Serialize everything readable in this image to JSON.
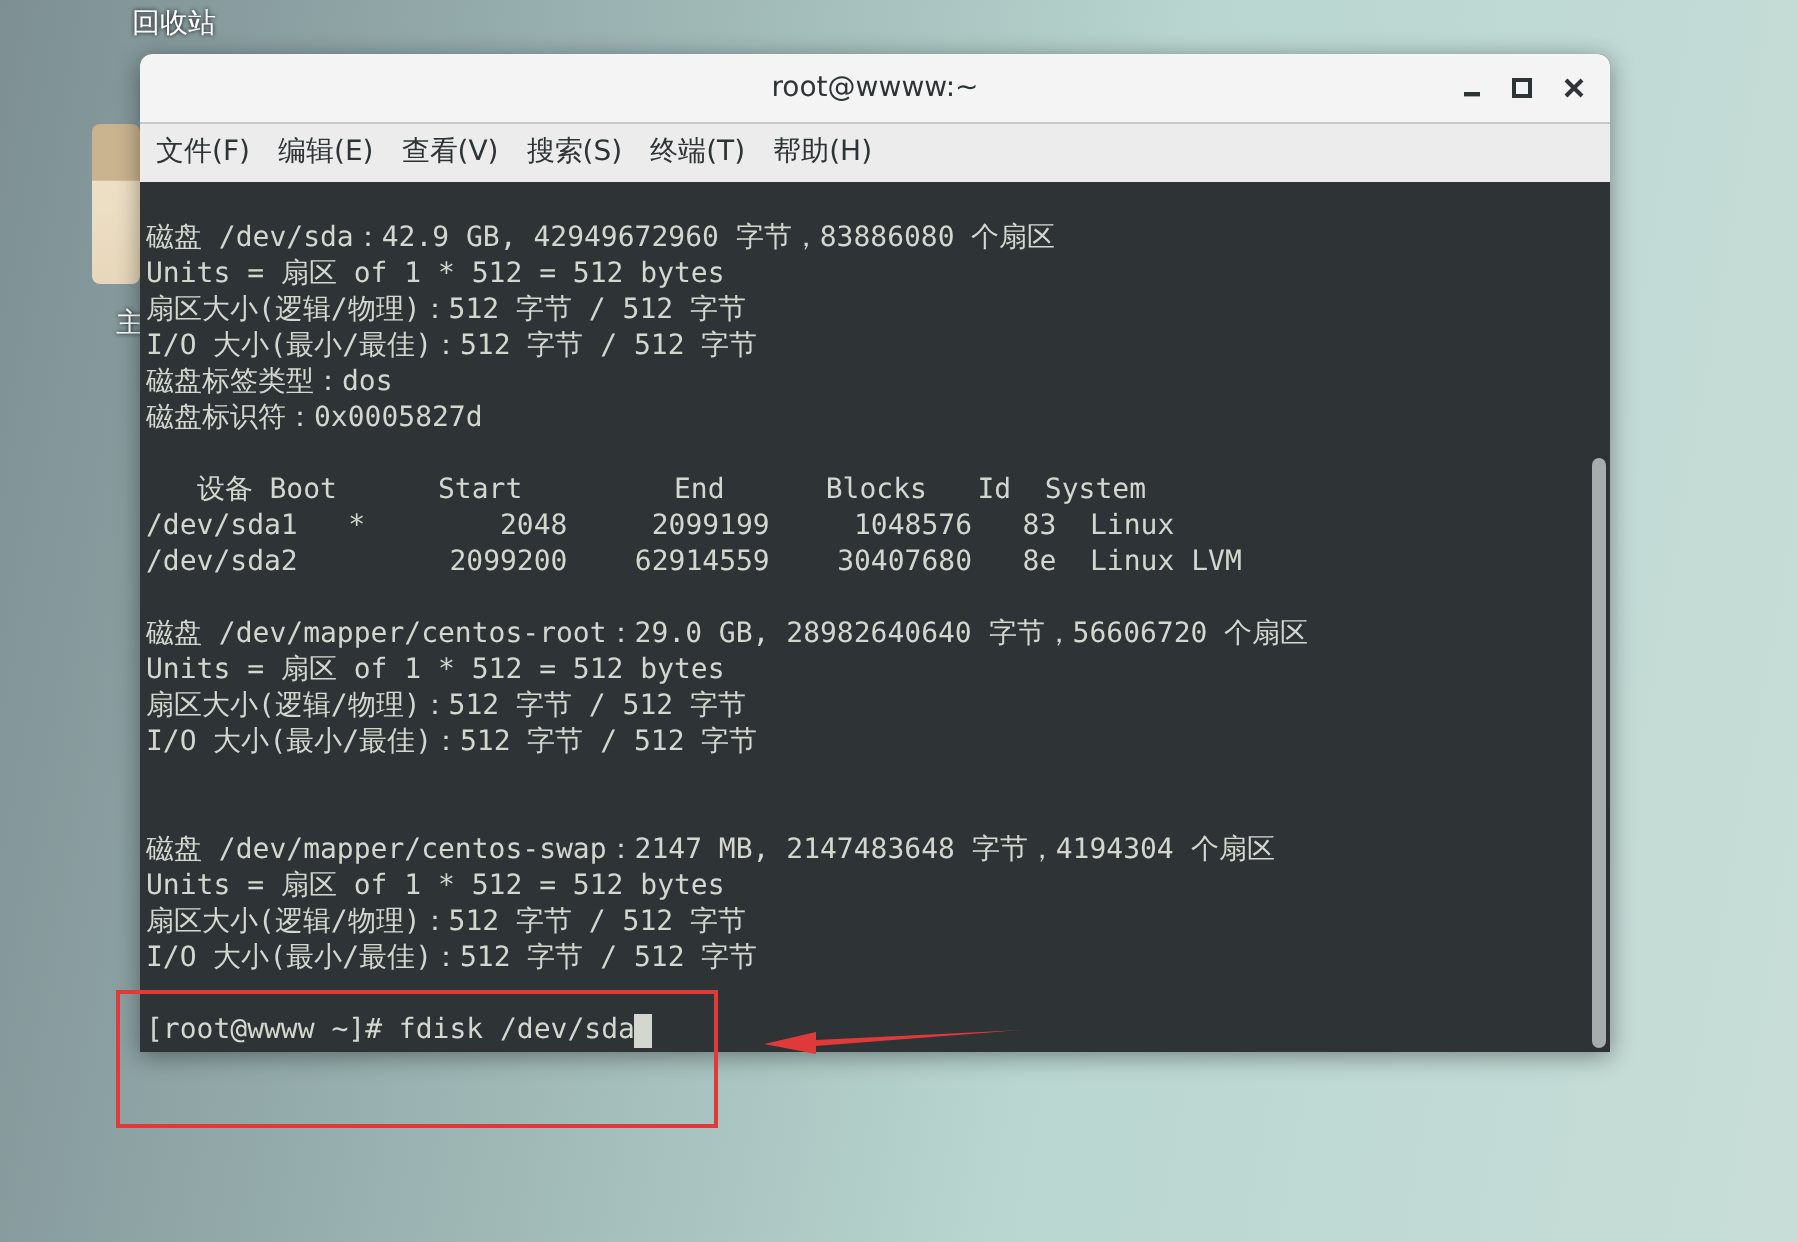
{
  "desktop": {
    "icons": [
      {
        "label": "回收站",
        "kind": "label-only"
      },
      {
        "label": "主",
        "kind": "folder"
      }
    ]
  },
  "window": {
    "title": "root@wwww:~",
    "menu": [
      {
        "label": "文件(F)"
      },
      {
        "label": "编辑(E)"
      },
      {
        "label": "查看(V)"
      },
      {
        "label": "搜索(S)"
      },
      {
        "label": "终端(T)"
      },
      {
        "label": "帮助(H)"
      }
    ]
  },
  "terminal": {
    "lines": [
      {
        "kind": "blank"
      },
      {
        "kind": "text",
        "text": "磁盘 /dev/sda：42.9 GB, 42949672960 字节，83886080 个扇区"
      },
      {
        "kind": "text",
        "text": "Units = 扇区 of 1 * 512 = 512 bytes"
      },
      {
        "kind": "text",
        "text": "扇区大小(逻辑/物理)：512 字节 / 512 字节"
      },
      {
        "kind": "text",
        "text": "I/O 大小(最小/最佳)：512 字节 / 512 字节"
      },
      {
        "kind": "text",
        "text": "磁盘标签类型：dos"
      },
      {
        "kind": "text",
        "text": "磁盘标识符：0x0005827d"
      },
      {
        "kind": "blank"
      },
      {
        "kind": "text",
        "text": "   设备 Boot      Start         End      Blocks   Id  System"
      },
      {
        "kind": "text",
        "text": "/dev/sda1   *        2048     2099199     1048576   83  Linux"
      },
      {
        "kind": "text",
        "text": "/dev/sda2         2099200    62914559    30407680   8e  Linux LVM"
      },
      {
        "kind": "blank"
      },
      {
        "kind": "text",
        "text": "磁盘 /dev/mapper/centos-root：29.0 GB, 28982640640 字节，56606720 个扇区"
      },
      {
        "kind": "text",
        "text": "Units = 扇区 of 1 * 512 = 512 bytes"
      },
      {
        "kind": "text",
        "text": "扇区大小(逻辑/物理)：512 字节 / 512 字节"
      },
      {
        "kind": "text",
        "text": "I/O 大小(最小/最佳)：512 字节 / 512 字节"
      },
      {
        "kind": "blank"
      },
      {
        "kind": "blank"
      },
      {
        "kind": "text",
        "text": "磁盘 /dev/mapper/centos-swap：2147 MB, 2147483648 字节，4194304 个扇区"
      },
      {
        "kind": "text",
        "text": "Units = 扇区 of 1 * 512 = 512 bytes"
      },
      {
        "kind": "text",
        "text": "扇区大小(逻辑/物理)：512 字节 / 512 字节"
      },
      {
        "kind": "text",
        "text": "I/O 大小(最小/最佳)：512 字节 / 512 字节"
      },
      {
        "kind": "blank"
      },
      {
        "kind": "prompt",
        "text": "[root@wwww ~]# fdisk /dev/sda"
      }
    ]
  }
}
